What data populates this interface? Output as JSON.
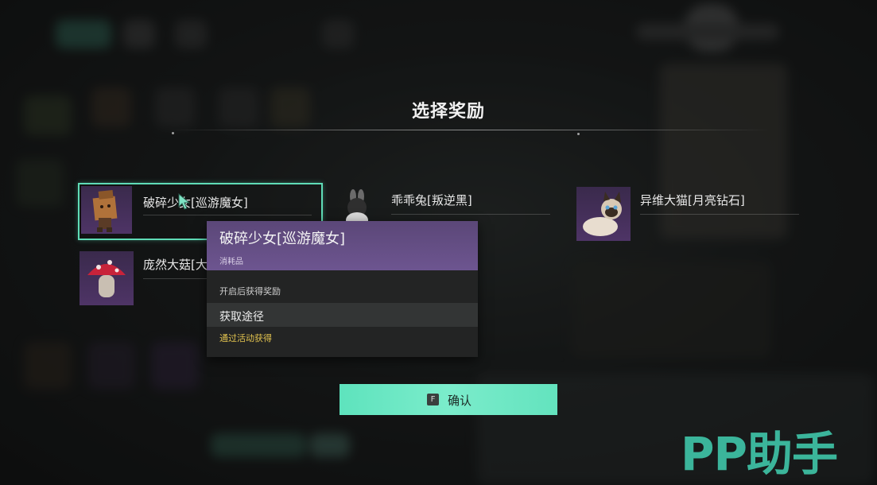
{
  "title": "选择奖励",
  "rewards": [
    {
      "name": "破碎少女[巡游魔女]",
      "selected": true
    },
    {
      "name": "乖乖兔[叛逆黑]",
      "selected": false
    },
    {
      "name": "异维大猫[月亮钻石]",
      "selected": false
    },
    {
      "name": "庞然大菇[大",
      "selected": false
    }
  ],
  "tooltip": {
    "name": "破碎少女[巡游魔女]",
    "category": "消耗品",
    "description": "开启后获得奖励",
    "obtain_title": "获取途径",
    "obtain_source": "通过活动获得"
  },
  "confirm": {
    "key": "F",
    "label": "确认"
  },
  "watermark": "PP助手",
  "colors": {
    "accent": "#5fdcb7",
    "tooltip_header": "#6d5590",
    "obtain_text": "#e3c44f",
    "watermark": "#3fc3a6"
  }
}
